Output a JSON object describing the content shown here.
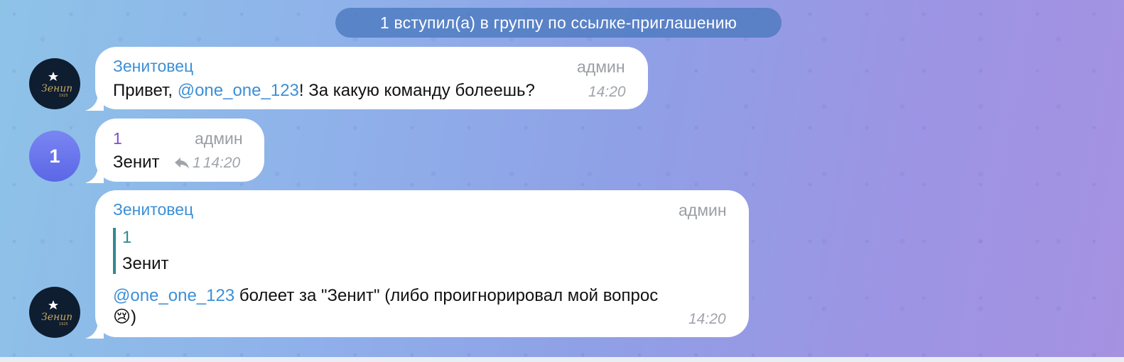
{
  "service_message": "1 вступил(а) в группу по ссылке-приглашению",
  "messages": [
    {
      "sender": "Зенитовец",
      "role": "админ",
      "text_parts": [
        "Привет, ",
        "@one_one_123",
        "! За какую команду болеешь?"
      ],
      "time": "14:20",
      "avatar": "zenit-logo"
    },
    {
      "sender": "1",
      "role": "админ",
      "text": "Зенит",
      "reply_count": "1",
      "time": "14:20",
      "avatar_letter": "1"
    },
    {
      "sender": "Зенитовец",
      "role": "админ",
      "quote_name": "1",
      "quote_text": "Зенит",
      "mention": "@one_one_123",
      "text_line1": " болеет за \"Зенит\" (либо проигнорировал мой вопрос",
      "emoji": "😢",
      "text_line2": ")",
      "time": "14:20",
      "avatar": "zenit-logo"
    }
  ],
  "colors": {
    "accent": "#3d8fd6",
    "bubble": "#ffffff",
    "service": "#4a78be"
  }
}
